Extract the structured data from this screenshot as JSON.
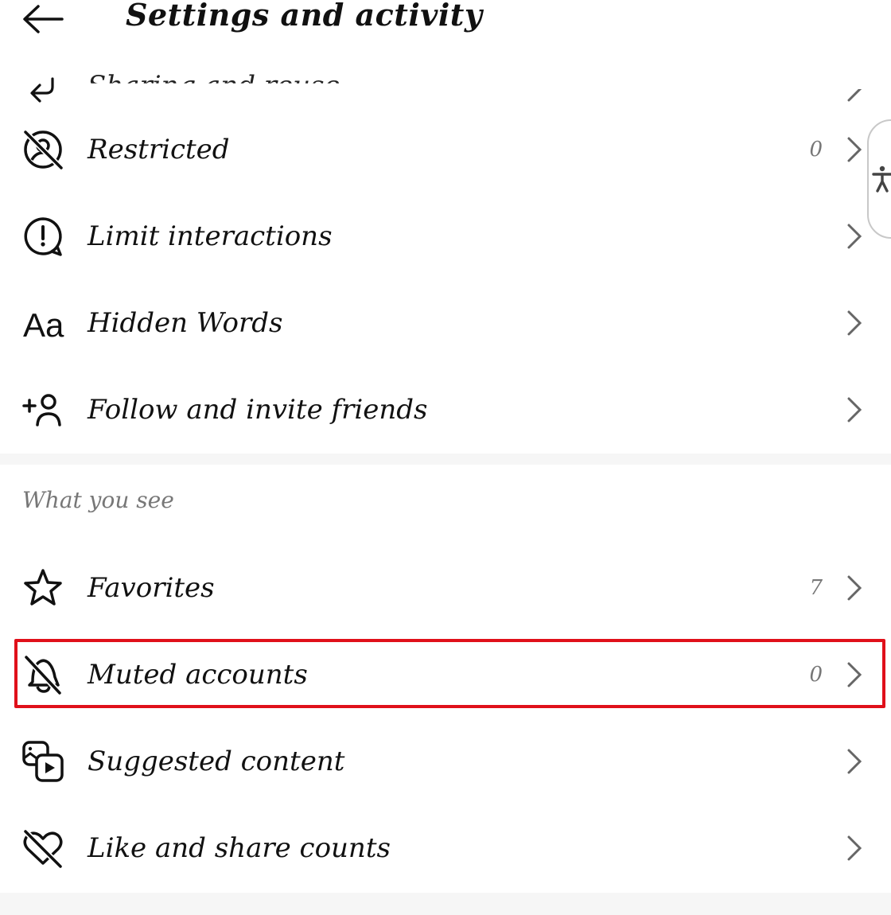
{
  "header": {
    "title": "Settings and activity",
    "back_icon": "arrow-left-icon"
  },
  "partial_row": {
    "label": "Sharing and reuse",
    "icon": "reply-arrow-icon"
  },
  "section1": {
    "items": [
      {
        "label": "Restricted",
        "count": "0",
        "icon": "restricted-icon"
      },
      {
        "label": "Limit interactions",
        "count": "",
        "icon": "limit-interactions-icon"
      },
      {
        "label": "Hidden Words",
        "count": "",
        "icon": "text-aa-icon"
      },
      {
        "label": "Follow and invite friends",
        "count": "",
        "icon": "add-person-icon"
      }
    ]
  },
  "section2": {
    "title": "What you see",
    "items": [
      {
        "label": "Favorites",
        "count": "7",
        "icon": "star-icon"
      },
      {
        "label": "Muted accounts",
        "count": "0",
        "icon": "bell-off-icon",
        "highlighted": true
      },
      {
        "label": "Suggested content",
        "count": "",
        "icon": "media-play-icon"
      },
      {
        "label": "Like and share counts",
        "count": "",
        "icon": "heart-off-icon"
      }
    ]
  },
  "accessibility_widget": {
    "icon": "accessibility-person-icon"
  },
  "colors": {
    "highlight_border": "#e0101a",
    "secondary_text": "#777777",
    "separator": "#f6f6f6"
  }
}
